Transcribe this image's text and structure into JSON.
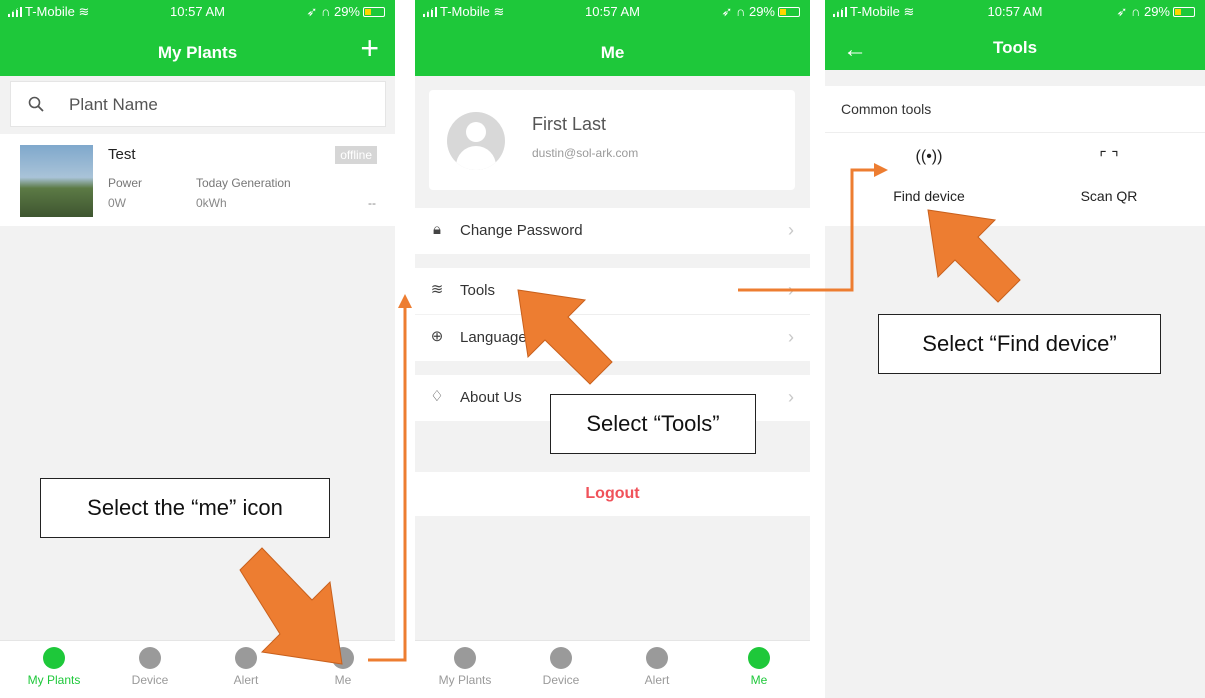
{
  "status_bar": {
    "carrier": "T-Mobile",
    "time": "10:57 AM",
    "battery": "29%"
  },
  "screen1": {
    "title": "My Plants",
    "search_placeholder": "Plant Name",
    "plant": {
      "name": "Test",
      "status": "offline",
      "power_label": "Power",
      "power_value": "0W",
      "today_label": "Today Generation",
      "today_value": "0kWh",
      "extra": "--"
    },
    "tabs": [
      {
        "label": "My Plants",
        "icon": "bolt-icon"
      },
      {
        "label": "Device",
        "icon": "device-icon"
      },
      {
        "label": "Alert",
        "icon": "alert-icon"
      },
      {
        "label": "Me",
        "icon": "person-icon"
      }
    ]
  },
  "screen2": {
    "title": "Me",
    "profile": {
      "name": "First Last",
      "email": "dustin@sol-ark.com"
    },
    "menu": [
      {
        "label": "Change Password",
        "icon": "lock-icon"
      },
      {
        "label": "Tools",
        "icon": "layers-icon"
      },
      {
        "label": "Language",
        "icon": "globe-icon"
      },
      {
        "label": "About Us",
        "icon": "badge-icon"
      }
    ],
    "logout": "Logout",
    "tabs": [
      {
        "label": "My Plants"
      },
      {
        "label": "Device"
      },
      {
        "label": "Alert"
      },
      {
        "label": "Me"
      }
    ]
  },
  "screen3": {
    "title": "Tools",
    "section_heading": "Common tools",
    "tools": [
      {
        "label": "Find device",
        "icon": "broadcast-icon"
      },
      {
        "label": "Scan QR",
        "icon": "scan-frame-icon"
      }
    ]
  },
  "annotations": {
    "callout_me": "Select the “me” icon",
    "callout_tools": "Select “Tools”",
    "callout_find": "Select “Find device”",
    "arrow_color": "#ed7d31"
  },
  "colors": {
    "brand_green": "#1ec83a",
    "logout_red": "#f0525a"
  }
}
